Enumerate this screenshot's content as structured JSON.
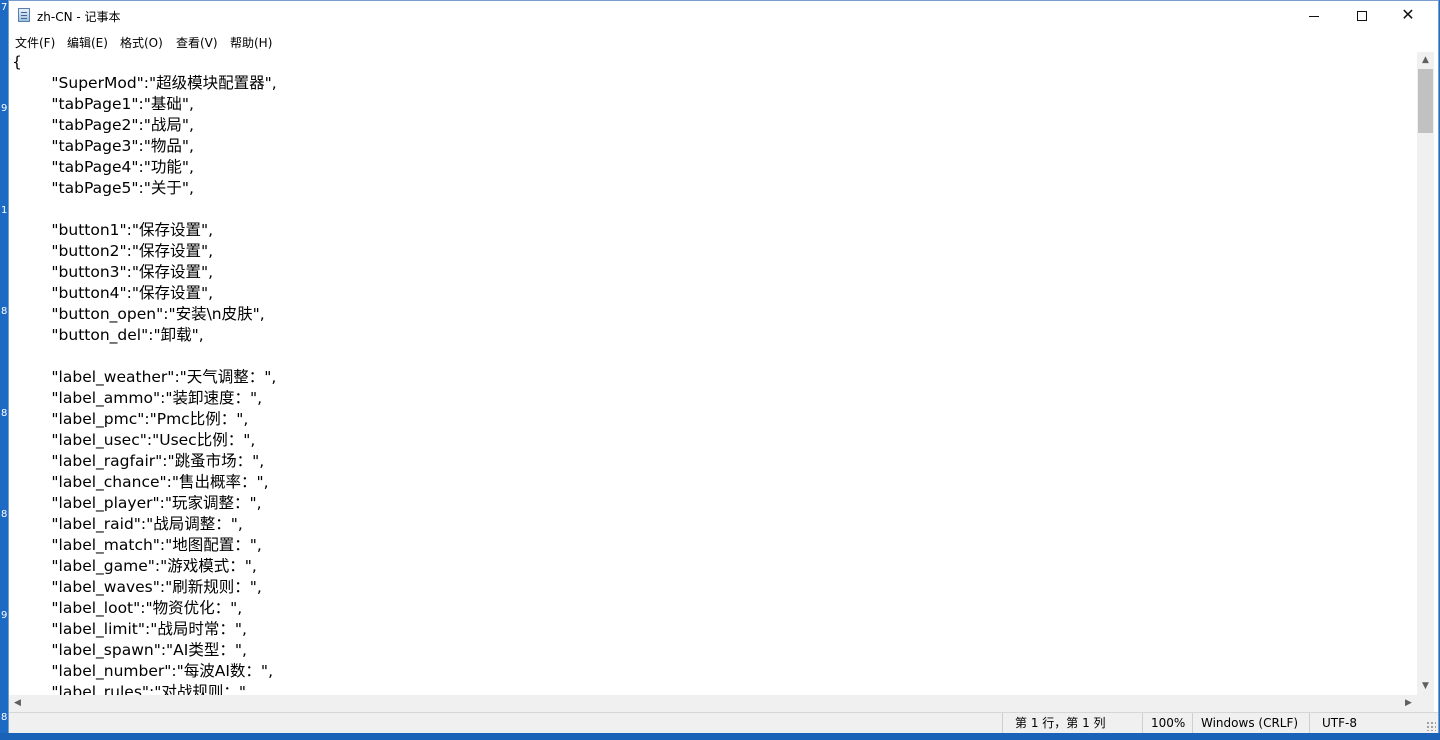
{
  "desktop": {
    "edge_digits": [
      "7",
      "9",
      "1",
      "8",
      "8",
      "8",
      "9",
      "8"
    ]
  },
  "window": {
    "title": "zh-CN - 记事本",
    "icon": "notepad-icon",
    "controls": {
      "minimize": "minimize-icon",
      "maximize": "maximize-icon",
      "close": "✕"
    }
  },
  "menu": [
    "文件(F)",
    "编辑(E)",
    "格式(O)",
    "查看(V)",
    "帮助(H)"
  ],
  "editor": {
    "content": "{\n\t\"SuperMod\":\"超级模块配置器\",\n\t\"tabPage1\":\"基础\",\n\t\"tabPage2\":\"战局\",\n\t\"tabPage3\":\"物品\",\n\t\"tabPage4\":\"功能\",\n\t\"tabPage5\":\"关于\",\n\n\t\"button1\":\"保存设置\",\n\t\"button2\":\"保存设置\",\n\t\"button3\":\"保存设置\",\n\t\"button4\":\"保存设置\",\n\t\"button_open\":\"安装\\n皮肤\",\n\t\"button_del\":\"卸载\",\n\n\t\"label_weather\":\"天气调整：\",\n\t\"label_ammo\":\"装卸速度：\",\n\t\"label_pmc\":\"Pmc比例：\",\n\t\"label_usec\":\"Usec比例：\",\n\t\"label_ragfair\":\"跳蚤市场：\",\n\t\"label_chance\":\"售出概率：\",\n\t\"label_player\":\"玩家调整：\",\n\t\"label_raid\":\"战局调整：\",\n\t\"label_match\":\"地图配置：\",\n\t\"label_game\":\"游戏模式：\",\n\t\"label_waves\":\"刷新规则：\",\n\t\"label_loot\":\"物资优化：\",\n\t\"label_limit\":\"战局时常：\",\n\t\"label_spawn\":\"AI类型：\",\n\t\"label_number\":\"每波AI数：\",\n\t\"label_rules\":\"对战规则：\","
  },
  "status": {
    "position": "第 1 行，第 1 列",
    "zoom": "100%",
    "line_ending": "Windows (CRLF)",
    "encoding": "UTF-8"
  },
  "colors": {
    "desktop": "#1f6fc7",
    "window_border": "#7a9ccf",
    "statusbar": "#f0f0f0"
  }
}
